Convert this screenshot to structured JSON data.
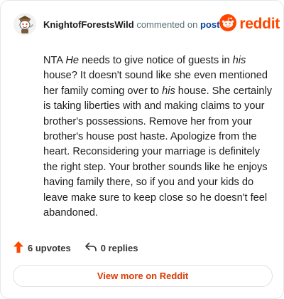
{
  "header": {
    "username": "KnightofForestsWild",
    "action_text": "commented on",
    "post_link": "post",
    "brand_name": "reddit",
    "brand_color": "#ff4500"
  },
  "comment": {
    "segments": [
      {
        "text": "NTA ",
        "italic": false
      },
      {
        "text": "He",
        "italic": true
      },
      {
        "text": " needs to give notice of guests in ",
        "italic": false
      },
      {
        "text": "his",
        "italic": true
      },
      {
        "text": " house? It doesn't sound like she even mentioned her family coming over to ",
        "italic": false
      },
      {
        "text": "his",
        "italic": true
      },
      {
        "text": " house. She certainly is taking liberties with and making claims to your brother's possessions. Remove her from your brother's house post haste. Apologize from the heart. Reconsidering your marriage is definitely the right step. Your brother sounds like he enjoys having family there, so if you and your kids do leave make sure to keep close so he doesn't feel abandoned.",
        "italic": false
      }
    ]
  },
  "footer": {
    "upvotes": "6 upvotes",
    "replies": "0 replies",
    "upvote_icon": "upvote-arrow-icon",
    "reply_icon": "reply-arrow-icon"
  },
  "cta": {
    "label": "View more on Reddit"
  }
}
